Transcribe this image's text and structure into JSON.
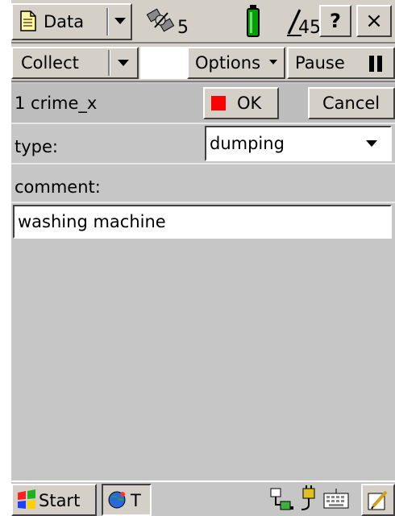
{
  "toolbar": {
    "data_label": "Data",
    "satellites": "5",
    "pdop": "45",
    "help_label": "?",
    "close_label": "×"
  },
  "command_bar": {
    "collect_label": "Collect",
    "options_label": "Options",
    "pause_label": "Pause"
  },
  "feature_bar": {
    "feature_name": "1 crime_x",
    "ok_label": "OK",
    "cancel_label": "Cancel"
  },
  "form": {
    "type_label": "type:",
    "type_value": "dumping",
    "comment_label": "comment:",
    "comment_value": "washing machine"
  },
  "taskbar": {
    "start_label": "Start",
    "task_label": "T"
  },
  "colors": {
    "ok_indicator": "#ff0000",
    "battery": "#00a000",
    "frame_gray": "#c6c6c6"
  }
}
